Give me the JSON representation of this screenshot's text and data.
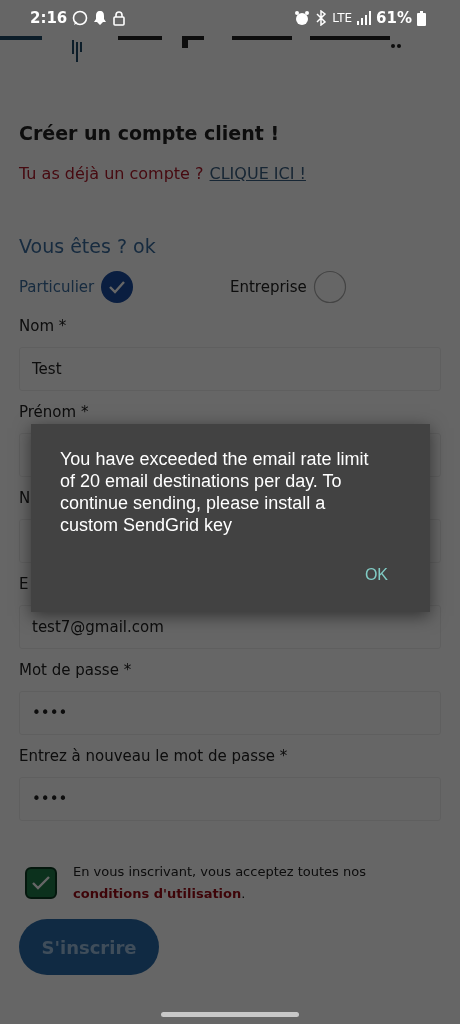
{
  "status_bar": {
    "time": "2:16",
    "network": "LTE",
    "battery": "61%"
  },
  "page": {
    "title": "Créer un compte client !",
    "login_prompt": {
      "text": "Tu as déjà un compte ?",
      "link": "CLIQUE ICI !"
    },
    "account_type": {
      "heading": "Vous êtes ? ok",
      "options": [
        {
          "label": "Particulier",
          "selected": true
        },
        {
          "label": "Entreprise",
          "selected": false
        }
      ]
    },
    "fields": [
      {
        "label": "Nom *",
        "value": "Test"
      },
      {
        "label": "Prénom *"
      },
      {
        "label": "N"
      },
      {
        "label": "E",
        "value": "test7@gmail.com"
      },
      {
        "label": "Mot de passe *",
        "value": "••••"
      },
      {
        "label": "Entrez à nouveau le mot de passe *",
        "value": "••••"
      }
    ],
    "terms": {
      "checked": true,
      "text": "En vous inscrivant, vous acceptez toutes nos **conditions d'utilisation**."
    },
    "submit": "S'inscrire"
  },
  "dialog": {
    "message": "You have exceeded the email rate limit of 20 email destinations per day. To continue sending, please install a custom SendGrid key",
    "button": "OK"
  }
}
